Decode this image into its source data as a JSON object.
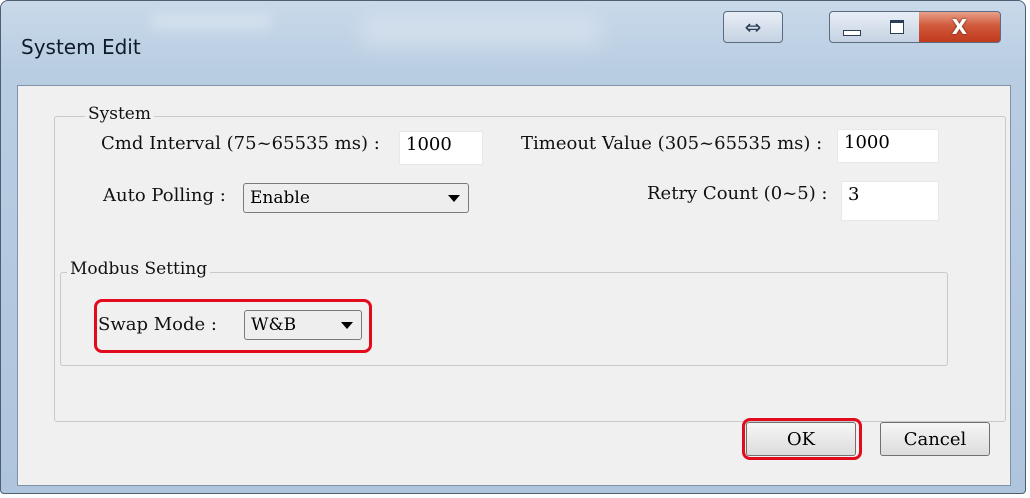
{
  "window": {
    "title": "System Edit",
    "swap_icon": "⇔",
    "close_icon": "X",
    "colors": {
      "highlight": "#e20a1d",
      "close": "#c1391d"
    }
  },
  "system_group": {
    "legend": "System",
    "cmd_interval": {
      "label": "Cmd Interval (75~65535 ms) :",
      "value": "1000"
    },
    "timeout_value": {
      "label": "Timeout Value (305~65535 ms) :",
      "value": "1000"
    },
    "auto_polling": {
      "label": "Auto Polling :",
      "value": "Enable"
    },
    "retry_count": {
      "label": "Retry Count (0~5) :",
      "value": "3"
    }
  },
  "modbus_group": {
    "legend": "Modbus Setting",
    "swap_mode": {
      "label": "Swap Mode :",
      "value": "W&B"
    }
  },
  "buttons": {
    "ok": "OK",
    "cancel": "Cancel"
  }
}
